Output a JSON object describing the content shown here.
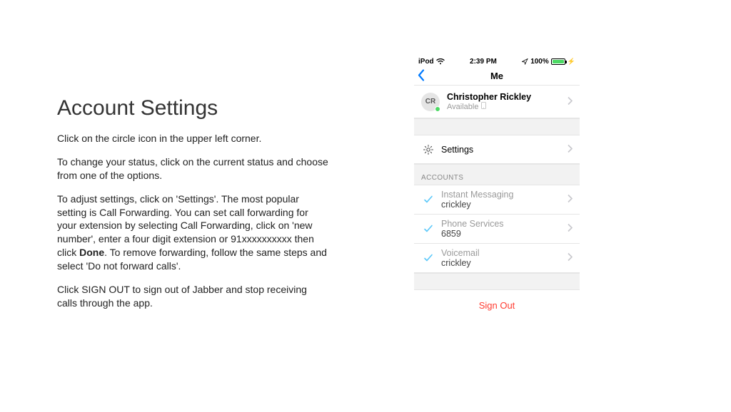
{
  "doc": {
    "title": "Account Settings",
    "p1": "Click on the circle icon in the upper left corner.",
    "p2": "To change your status, click on the current status and choose from one of the options.",
    "p3a": "To adjust settings, click on 'Settings'.  The most popular setting is Call Forwarding.  You can set call forwarding for your extension by selecting Call Forwarding, click on 'new number', enter a four digit extension or 91xxxxxxxxxx then click ",
    "p3_bold": "Done",
    "p3b": ".  To remove forwarding, follow the same steps and select 'Do not forward calls'.",
    "p4": "Click SIGN OUT to sign out of Jabber and stop receiving calls through the app."
  },
  "statusbar": {
    "device": "iPod",
    "time": "2:39 PM",
    "battery_pct": "100%"
  },
  "navbar": {
    "title": "Me"
  },
  "profile": {
    "initials": "CR",
    "name": "Christopher Rickley",
    "status": "Available"
  },
  "settings_row": {
    "label": "Settings"
  },
  "accounts_header": "ACCOUNTS",
  "accounts": [
    {
      "title": "Instant Messaging",
      "sub": "crickley"
    },
    {
      "title": "Phone Services",
      "sub": "6859"
    },
    {
      "title": "Voicemail",
      "sub": "crickley"
    }
  ],
  "signout": "Sign Out"
}
